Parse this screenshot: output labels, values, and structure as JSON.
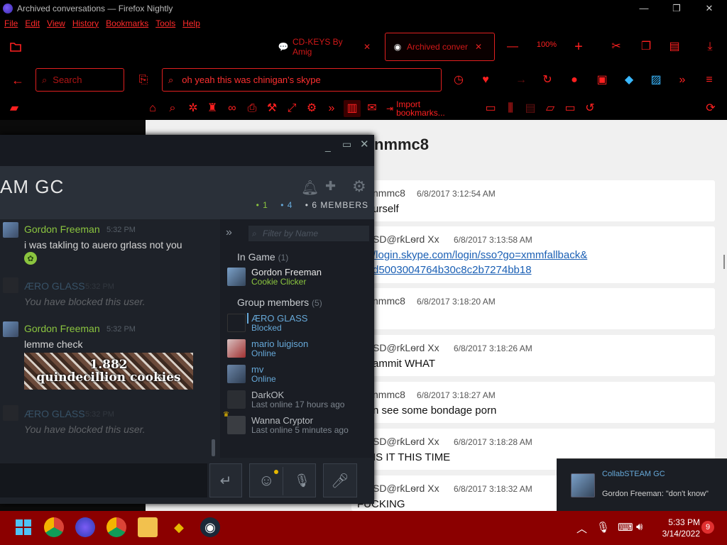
{
  "window": {
    "title": "Archived conversations — Firefox Nightly"
  },
  "menu": [
    "File",
    "Edit",
    "View",
    "History",
    "Bookmarks",
    "Tools",
    "Help"
  ],
  "tabs": [
    {
      "label": "CD-KEYS By Amig",
      "icon": "chat-bubble-icon",
      "active": false
    },
    {
      "label": "Archived conver",
      "icon": "steam-icon",
      "active": true
    }
  ],
  "toolbar": {
    "zoom": "100%"
  },
  "nav": {
    "search_placeholder": "Search",
    "url": "oh yeah this was chinigan's skype"
  },
  "bookmarks": {
    "import_label": "Import bookmarks..."
  },
  "page": {
    "title": "nmmc8",
    "messages": [
      {
        "author": "nmmc8",
        "time": "6/8/2017 3:12:54 AM",
        "body": "urself"
      },
      {
        "author": "ЅD@rƙLѳrd Xx",
        "time": "6/8/2017 3:13:58 AM",
        "link1": "/login.skype.com/login/sso?go=xmmfallback&",
        "link2": "d5003004764b30c8c2b7274bb18"
      },
      {
        "author": "nmmc8",
        "time": "6/8/2017 3:18:20 AM",
        "body": ""
      },
      {
        "author": "ЅD@rƙLѳrd Xx",
        "time": "6/8/2017 3:18:26 AM",
        "body": "ammit WHAT"
      },
      {
        "author": "nmmc8",
        "time": "6/8/2017 3:18:27 AM",
        "body": "n see some bondage porn"
      },
      {
        "author": "ЅD@rƙLѳrd Xx",
        "time": "6/8/2017 3:18:28 AM",
        "body": "IS IT THIS TIME"
      },
      {
        "author": "ЅD@rƙLѳrd Xx",
        "time": "6/8/2017 3:18:32 AM",
        "body": "FUCKING"
      }
    ]
  },
  "steam": {
    "group_name": "AM GC",
    "count_ingame": "1",
    "count_online": "4",
    "count_members": "6 MEMBERS",
    "chat": [
      {
        "author": "Gordon Freeman",
        "time": "5:32 PM",
        "text": "i was takling to auero grlass not you",
        "blocked": false
      },
      {
        "author": "ÆRO GLASS",
        "time": "5:32 PM",
        "text": "You have blocked this user.",
        "blocked": true
      },
      {
        "author": "Gordon Freeman",
        "time": "5:32 PM",
        "text": "lemme check",
        "blocked": false
      },
      {
        "author": "ÆRO GLASS",
        "time": "5:32 PM",
        "text": "You have blocked this user.",
        "blocked": true
      }
    ],
    "cookie_image": {
      "number": "1.882",
      "text": "quindecillion cookies"
    },
    "filter_placeholder": "Filter by Name",
    "sections": {
      "ingame_label": "In Game",
      "ingame_count": "(1)",
      "group_label": "Group members",
      "group_count": "(5)"
    },
    "members": [
      {
        "name": "Gordon Freeman",
        "status": "Cookie Clicker",
        "state": "ingame"
      },
      {
        "name": "ÆRO GLASS",
        "status": "Blocked",
        "state": "online"
      },
      {
        "name": "mario luigison",
        "status": "Online",
        "state": "online"
      },
      {
        "name": "mv",
        "status": "Online",
        "state": "online"
      },
      {
        "name": "DarkOK",
        "status": "Last online 17 hours ago",
        "state": "offline"
      },
      {
        "name": "Wanna Cryptor",
        "status": "Last online 5 minutes ago",
        "state": "offline"
      }
    ]
  },
  "notification": {
    "group": "CollabSTEAM GC",
    "message": "Gordon Freeman: \"don't know\""
  },
  "taskbar": {
    "time": "5:33 PM",
    "date": "3/14/2022",
    "badge": "9"
  },
  "colors": {
    "accent": "#e02020",
    "steam_ingame": "#8bc53f",
    "steam_online": "#66a8d8",
    "taskbar": "#8b0000"
  }
}
